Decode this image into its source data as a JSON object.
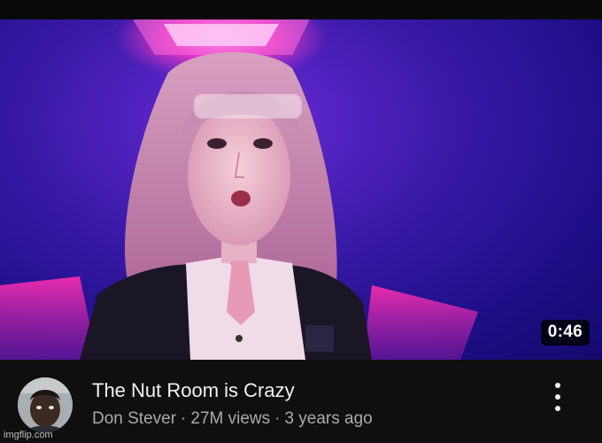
{
  "video": {
    "duration": "0:46",
    "title": "The Nut Room is Crazy",
    "channel": "Don Stever",
    "views": "27M views",
    "age": "3 years ago",
    "separator": "·"
  },
  "icons": {
    "more": "more-vert-icon"
  },
  "watermark": "imgflip.com",
  "colors": {
    "background": "#0f0f0f",
    "title": "#f1f1f1",
    "meta": "#aaaaaa",
    "thumbnail_glow": "#ff3cc8",
    "thumbnail_bg": "#2a14a0"
  }
}
